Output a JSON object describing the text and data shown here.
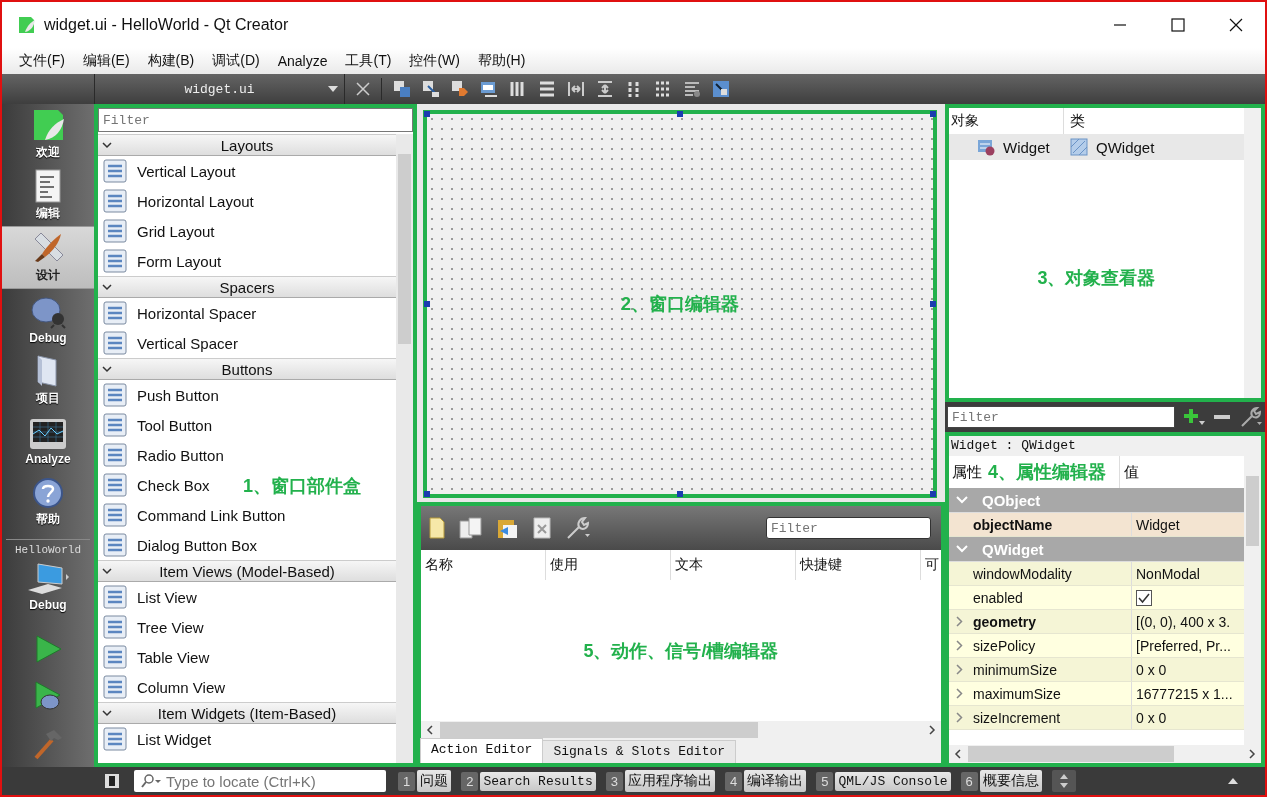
{
  "window": {
    "title": "widget.ui - HelloWorld - Qt Creator"
  },
  "menu": [
    "文件(F)",
    "编辑(E)",
    "构建(B)",
    "调试(D)",
    "Analyze",
    "工具(T)",
    "控件(W)",
    "帮助(H)"
  ],
  "editor_toolbar": {
    "file": "widget.ui"
  },
  "mode_bar": {
    "modes": [
      {
        "label": "欢迎",
        "kind": "welcome",
        "selected": false
      },
      {
        "label": "编辑",
        "kind": "edit",
        "selected": false
      },
      {
        "label": "设计",
        "kind": "design",
        "selected": true
      },
      {
        "label": "Debug",
        "kind": "debug",
        "selected": false
      },
      {
        "label": "项目",
        "kind": "projects",
        "selected": false
      },
      {
        "label": "Analyze",
        "kind": "analyze",
        "selected": false
      },
      {
        "label": "帮助",
        "kind": "help",
        "selected": false
      }
    ],
    "project": "HelloWorld",
    "kit": "Debug"
  },
  "widget_box": {
    "filter_placeholder": "Filter",
    "annotation": "1、窗口部件盒",
    "categories": [
      {
        "name": "Layouts",
        "items": [
          "Vertical Layout",
          "Horizontal Layout",
          "Grid Layout",
          "Form Layout"
        ]
      },
      {
        "name": "Spacers",
        "items": [
          "Horizontal Spacer",
          "Vertical Spacer"
        ]
      },
      {
        "name": "Buttons",
        "items": [
          "Push Button",
          "Tool Button",
          "Radio Button",
          "Check Box",
          "Command Link Button",
          "Dialog Button Box"
        ]
      },
      {
        "name": "Item Views (Model-Based)",
        "items": [
          "List View",
          "Tree View",
          "Table View",
          "Column View"
        ]
      },
      {
        "name": "Item Widgets (Item-Based)",
        "items": [
          "List Widget"
        ]
      }
    ]
  },
  "form_editor": {
    "annotation": "2、窗口编辑器"
  },
  "action_editor": {
    "filter_placeholder": "Filter",
    "columns": [
      "名称",
      "使用",
      "文本",
      "快捷键",
      "可"
    ],
    "annotation": "5、动作、信号/槽编辑器",
    "tabs": [
      {
        "label": "Action Editor",
        "selected": true
      },
      {
        "label": "Signals & Slots Editor",
        "selected": false
      }
    ]
  },
  "object_inspector": {
    "columns": [
      "对象",
      "类"
    ],
    "rows": [
      {
        "object": "Widget",
        "class": "QWidget",
        "selected": true
      }
    ],
    "annotation": "3、对象查看器"
  },
  "property_editor": {
    "filter_placeholder": "Filter",
    "title": "Widget : QWidget",
    "columns": [
      "属性",
      "值"
    ],
    "annotation": "4、属性编辑器",
    "groups": [
      {
        "name": "QObject",
        "expanded": true,
        "color": "#fdeedb",
        "properties": [
          {
            "name": "objectName",
            "kind": "text",
            "value": "Widget",
            "changed": true,
            "expandable": false
          }
        ]
      },
      {
        "name": "QWidget",
        "expanded": true,
        "color": "#ffffe0",
        "properties": [
          {
            "name": "windowModality",
            "kind": "text",
            "value": "NonModal",
            "changed": false,
            "expandable": false
          },
          {
            "name": "enabled",
            "kind": "checkbox",
            "checked": true,
            "changed": false,
            "expandable": false
          },
          {
            "name": "geometry",
            "kind": "text",
            "value": "[(0, 0), 400 x 3.",
            "changed": true,
            "expandable": true
          },
          {
            "name": "sizePolicy",
            "kind": "text",
            "value": "[Preferred, Pr...",
            "changed": false,
            "expandable": true
          },
          {
            "name": "minimumSize",
            "kind": "text",
            "value": "0 x 0",
            "changed": false,
            "expandable": true
          },
          {
            "name": "maximumSize",
            "kind": "text",
            "value": "16777215 x 1...",
            "changed": false,
            "expandable": true
          },
          {
            "name": "sizeIncrement",
            "kind": "text",
            "value": "0 x 0",
            "changed": false,
            "expandable": true
          }
        ]
      }
    ]
  },
  "status_bar": {
    "locator_placeholder": "Type to locate (Ctrl+K)",
    "panes": [
      {
        "number": "1",
        "label": "问题"
      },
      {
        "number": "2",
        "label": "Search Results"
      },
      {
        "number": "3",
        "label": "应用程序输出"
      },
      {
        "number": "4",
        "label": "编译输出"
      },
      {
        "number": "5",
        "label": "QML/JS Console"
      },
      {
        "number": "6",
        "label": "概要信息"
      }
    ]
  }
}
